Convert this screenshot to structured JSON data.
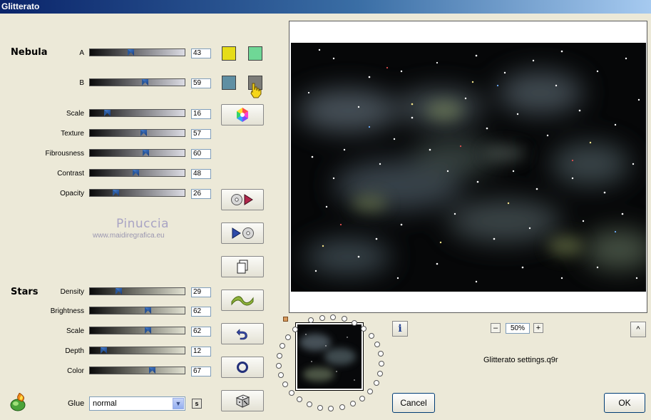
{
  "window": {
    "title": "Glitterato"
  },
  "nebula": {
    "title": "Nebula",
    "rows": [
      {
        "label": "A",
        "value": "43",
        "pct": 43
      },
      {
        "label": "B",
        "value": "59",
        "pct": 59
      },
      {
        "label": "Scale",
        "value": "16",
        "pct": 16
      },
      {
        "label": "Texture",
        "value": "57",
        "pct": 57
      },
      {
        "label": "Fibrousness",
        "value": "60",
        "pct": 60
      },
      {
        "label": "Contrast",
        "value": "48",
        "pct": 48
      },
      {
        "label": "Opacity",
        "value": "26",
        "pct": 26
      }
    ],
    "colors": {
      "a1": "#e6dc18",
      "a2": "#6fd796",
      "b1": "#5f8fa3",
      "b2": "#7c7c78"
    }
  },
  "stars": {
    "title": "Stars",
    "rows": [
      {
        "label": "Density",
        "value": "29",
        "pct": 29
      },
      {
        "label": "Brightness",
        "value": "62",
        "pct": 62
      },
      {
        "label": "Scale",
        "value": "62",
        "pct": 62
      },
      {
        "label": "Depth",
        "value": "12",
        "pct": 12
      },
      {
        "label": "Color",
        "value": "67",
        "pct": 67
      }
    ]
  },
  "watermark": {
    "line1": "Pinuccia",
    "line2": "www.maidiregrafica.eu"
  },
  "glue": {
    "label": "Glue",
    "value": "normal",
    "s_label": "s"
  },
  "zoom": {
    "minus": "–",
    "value": "50%",
    "plus": "+"
  },
  "settings_file": "Glitterato settings.q9r",
  "buttons": {
    "cancel": "Cancel",
    "ok": "OK",
    "info": "i",
    "collapse": "^"
  }
}
